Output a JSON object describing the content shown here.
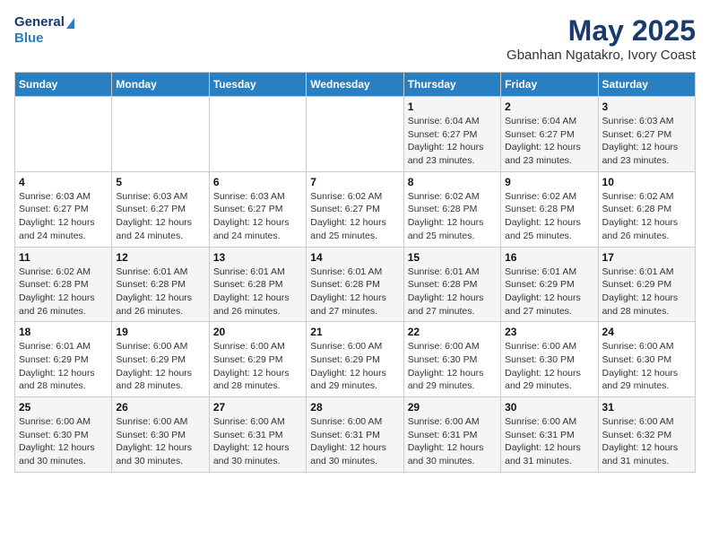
{
  "header": {
    "logo_line1": "General",
    "logo_line2": "Blue",
    "title": "May 2025",
    "subtitle": "Gbanhan Ngatakro, Ivory Coast"
  },
  "days_of_week": [
    "Sunday",
    "Monday",
    "Tuesday",
    "Wednesday",
    "Thursday",
    "Friday",
    "Saturday"
  ],
  "weeks": [
    [
      {
        "day": "",
        "info": ""
      },
      {
        "day": "",
        "info": ""
      },
      {
        "day": "",
        "info": ""
      },
      {
        "day": "",
        "info": ""
      },
      {
        "day": "1",
        "info": "Sunrise: 6:04 AM\nSunset: 6:27 PM\nDaylight: 12 hours\nand 23 minutes."
      },
      {
        "day": "2",
        "info": "Sunrise: 6:04 AM\nSunset: 6:27 PM\nDaylight: 12 hours\nand 23 minutes."
      },
      {
        "day": "3",
        "info": "Sunrise: 6:03 AM\nSunset: 6:27 PM\nDaylight: 12 hours\nand 23 minutes."
      }
    ],
    [
      {
        "day": "4",
        "info": "Sunrise: 6:03 AM\nSunset: 6:27 PM\nDaylight: 12 hours\nand 24 minutes."
      },
      {
        "day": "5",
        "info": "Sunrise: 6:03 AM\nSunset: 6:27 PM\nDaylight: 12 hours\nand 24 minutes."
      },
      {
        "day": "6",
        "info": "Sunrise: 6:03 AM\nSunset: 6:27 PM\nDaylight: 12 hours\nand 24 minutes."
      },
      {
        "day": "7",
        "info": "Sunrise: 6:02 AM\nSunset: 6:27 PM\nDaylight: 12 hours\nand 25 minutes."
      },
      {
        "day": "8",
        "info": "Sunrise: 6:02 AM\nSunset: 6:28 PM\nDaylight: 12 hours\nand 25 minutes."
      },
      {
        "day": "9",
        "info": "Sunrise: 6:02 AM\nSunset: 6:28 PM\nDaylight: 12 hours\nand 25 minutes."
      },
      {
        "day": "10",
        "info": "Sunrise: 6:02 AM\nSunset: 6:28 PM\nDaylight: 12 hours\nand 26 minutes."
      }
    ],
    [
      {
        "day": "11",
        "info": "Sunrise: 6:02 AM\nSunset: 6:28 PM\nDaylight: 12 hours\nand 26 minutes."
      },
      {
        "day": "12",
        "info": "Sunrise: 6:01 AM\nSunset: 6:28 PM\nDaylight: 12 hours\nand 26 minutes."
      },
      {
        "day": "13",
        "info": "Sunrise: 6:01 AM\nSunset: 6:28 PM\nDaylight: 12 hours\nand 26 minutes."
      },
      {
        "day": "14",
        "info": "Sunrise: 6:01 AM\nSunset: 6:28 PM\nDaylight: 12 hours\nand 27 minutes."
      },
      {
        "day": "15",
        "info": "Sunrise: 6:01 AM\nSunset: 6:28 PM\nDaylight: 12 hours\nand 27 minutes."
      },
      {
        "day": "16",
        "info": "Sunrise: 6:01 AM\nSunset: 6:29 PM\nDaylight: 12 hours\nand 27 minutes."
      },
      {
        "day": "17",
        "info": "Sunrise: 6:01 AM\nSunset: 6:29 PM\nDaylight: 12 hours\nand 28 minutes."
      }
    ],
    [
      {
        "day": "18",
        "info": "Sunrise: 6:01 AM\nSunset: 6:29 PM\nDaylight: 12 hours\nand 28 minutes."
      },
      {
        "day": "19",
        "info": "Sunrise: 6:00 AM\nSunset: 6:29 PM\nDaylight: 12 hours\nand 28 minutes."
      },
      {
        "day": "20",
        "info": "Sunrise: 6:00 AM\nSunset: 6:29 PM\nDaylight: 12 hours\nand 28 minutes."
      },
      {
        "day": "21",
        "info": "Sunrise: 6:00 AM\nSunset: 6:29 PM\nDaylight: 12 hours\nand 29 minutes."
      },
      {
        "day": "22",
        "info": "Sunrise: 6:00 AM\nSunset: 6:30 PM\nDaylight: 12 hours\nand 29 minutes."
      },
      {
        "day": "23",
        "info": "Sunrise: 6:00 AM\nSunset: 6:30 PM\nDaylight: 12 hours\nand 29 minutes."
      },
      {
        "day": "24",
        "info": "Sunrise: 6:00 AM\nSunset: 6:30 PM\nDaylight: 12 hours\nand 29 minutes."
      }
    ],
    [
      {
        "day": "25",
        "info": "Sunrise: 6:00 AM\nSunset: 6:30 PM\nDaylight: 12 hours\nand 30 minutes."
      },
      {
        "day": "26",
        "info": "Sunrise: 6:00 AM\nSunset: 6:30 PM\nDaylight: 12 hours\nand 30 minutes."
      },
      {
        "day": "27",
        "info": "Sunrise: 6:00 AM\nSunset: 6:31 PM\nDaylight: 12 hours\nand 30 minutes."
      },
      {
        "day": "28",
        "info": "Sunrise: 6:00 AM\nSunset: 6:31 PM\nDaylight: 12 hours\nand 30 minutes."
      },
      {
        "day": "29",
        "info": "Sunrise: 6:00 AM\nSunset: 6:31 PM\nDaylight: 12 hours\nand 30 minutes."
      },
      {
        "day": "30",
        "info": "Sunrise: 6:00 AM\nSunset: 6:31 PM\nDaylight: 12 hours\nand 31 minutes."
      },
      {
        "day": "31",
        "info": "Sunrise: 6:00 AM\nSunset: 6:32 PM\nDaylight: 12 hours\nand 31 minutes."
      }
    ]
  ]
}
